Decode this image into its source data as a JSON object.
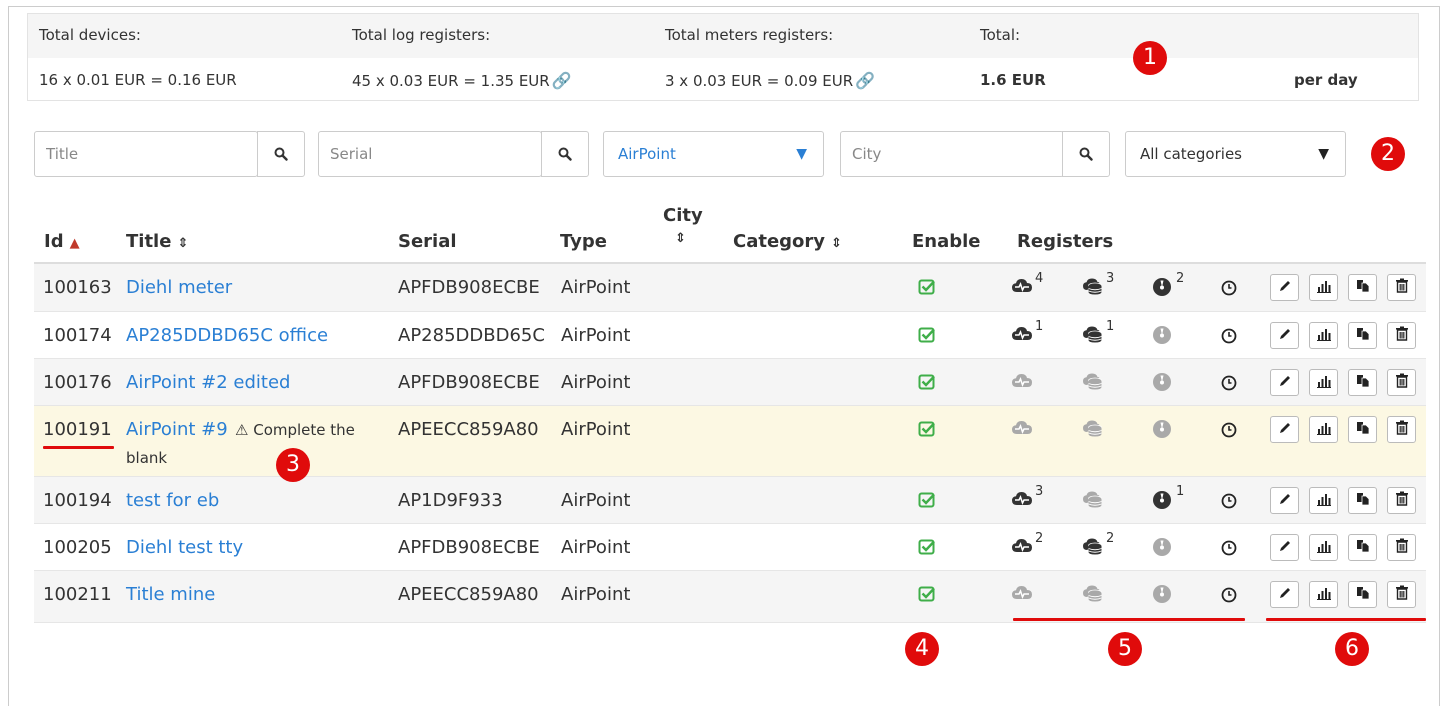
{
  "summary": {
    "devices_label": "Total devices:",
    "devices_value": "16 x 0.01 EUR = 0.16 EUR",
    "log_label": "Total log registers:",
    "log_value": "45 x 0.03 EUR = 1.35 EUR",
    "meters_label": "Total meters registers:",
    "meters_value": "3 x 0.03 EUR = 0.09 EUR",
    "total_label": "Total:",
    "total_value": "1.6 EUR",
    "period": "per day"
  },
  "filters": {
    "title_placeholder": "Title",
    "serial_placeholder": "Serial",
    "type_selected": "AirPoint",
    "city_placeholder": "City",
    "category_selected": "All categories"
  },
  "columns": {
    "id": "Id",
    "title": "Title",
    "serial": "Serial",
    "type": "Type",
    "city": "City",
    "category": "Category",
    "enable": "Enable",
    "registers": "Registers"
  },
  "rows": [
    {
      "id": "100163",
      "title": "Diehl meter",
      "warning": "",
      "warning2": "",
      "serial": "APFDB908ECBE",
      "type": "AirPoint",
      "log_count": "4",
      "db_count": "3",
      "meter_count": "2"
    },
    {
      "id": "100174",
      "title": "AP285DDBD65C office",
      "warning": "",
      "warning2": "",
      "serial": "AP285DDBD65C",
      "type": "AirPoint",
      "log_count": "1",
      "db_count": "1",
      "meter_count": ""
    },
    {
      "id": "100176",
      "title": "AirPoint #2 edited",
      "warning": "",
      "warning2": "",
      "serial": "APFDB908ECBE",
      "type": "AirPoint",
      "log_count": "",
      "db_count": "",
      "meter_count": ""
    },
    {
      "id": "100191",
      "title": "AirPoint #9",
      "warning": "Complete the",
      "warning2": "blank",
      "serial": "APEECC859A80",
      "type": "AirPoint",
      "log_count": "",
      "db_count": "",
      "meter_count": ""
    },
    {
      "id": "100194",
      "title": "test for eb",
      "warning": "",
      "warning2": "",
      "serial": "AP1D9F933",
      "type": "AirPoint",
      "log_count": "3",
      "db_count": "",
      "meter_count": "1"
    },
    {
      "id": "100205",
      "title": "Diehl test tty",
      "warning": "",
      "warning2": "",
      "serial": "APFDB908ECBE",
      "type": "AirPoint",
      "log_count": "2",
      "db_count": "2",
      "meter_count": ""
    },
    {
      "id": "100211",
      "title": "Title mine",
      "warning": "",
      "warning2": "",
      "serial": "APEECC859A80",
      "type": "AirPoint",
      "log_count": "",
      "db_count": "",
      "meter_count": ""
    }
  ],
  "annotations": [
    "1",
    "2",
    "3",
    "4",
    "5",
    "6"
  ],
  "colors": {
    "link": "#2a7fd4",
    "enabled": "#3fae49",
    "active_icon": "#333333",
    "inactive_icon": "#a9a9a9",
    "badge": "#e00b0b",
    "warning_row": "#fcf8e3",
    "sort_active": "#c0392b"
  },
  "icons": {
    "search": "search-icon",
    "enable": "check-square-icon",
    "log_register": "cloud-pulse-icon",
    "db_register": "cloud-database-icon",
    "meter_register": "gauge-icon",
    "schedule": "clock-icon",
    "edit": "pencil-icon",
    "stats": "bar-chart-icon",
    "copy": "copy-icon",
    "delete": "trash-icon",
    "warning": "warning-triangle-icon"
  }
}
